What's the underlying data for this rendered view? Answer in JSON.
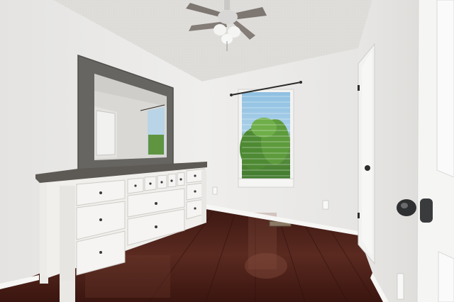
{
  "scene": {
    "kind": "photo",
    "subject": "bedroom-interior",
    "colors": {
      "wall": "#ecebe9",
      "wall_shadow": "#dcdbd8",
      "ceiling": "#dedcd9",
      "floor": "#4a1f16",
      "floor_highlight": "#7a4336",
      "dresser": "#f2f1ee",
      "dresser_top": "#5d5954",
      "mirror_frame": "#6a6965",
      "window_glass": "#88b7d9",
      "foliage": "#5a8f3c",
      "door": "#f4f4f3",
      "knob": "#3a3b3d"
    }
  }
}
